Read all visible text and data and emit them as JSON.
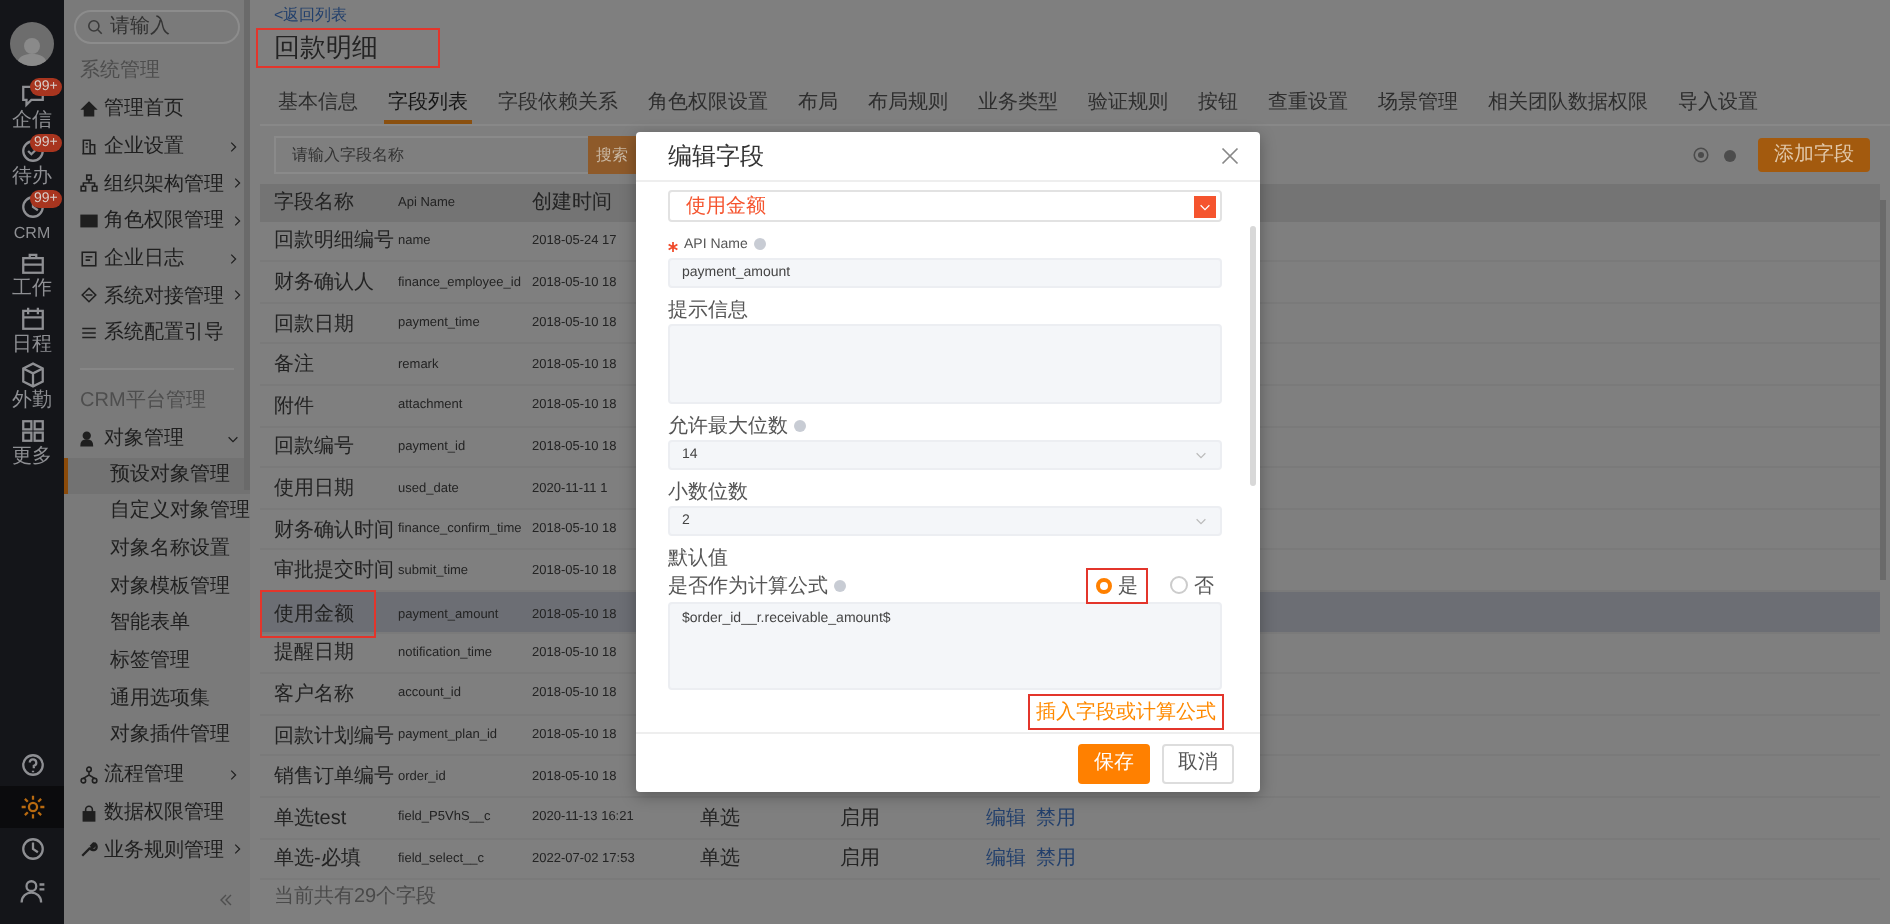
{
  "rail": {
    "items": [
      {
        "label": "企信",
        "badge": "99+"
      },
      {
        "label": "待办",
        "badge": "99+"
      },
      {
        "label": "CRM",
        "badge": "99+"
      },
      {
        "label": "工作"
      },
      {
        "label": "日程"
      },
      {
        "label": "外勤"
      },
      {
        "label": "更多"
      }
    ],
    "bottom": [
      {
        "selected": false
      },
      {
        "selected": true
      },
      {
        "selected": false
      },
      {
        "selected": false
      }
    ]
  },
  "sidebar": {
    "search": {
      "placeholder": "请输入"
    },
    "sections": [
      {
        "title": "系统管理",
        "items": [
          {
            "label": "管理首页",
            "expandable": false,
            "expanded": false
          },
          {
            "label": "企业设置",
            "expandable": true,
            "expanded": false
          },
          {
            "label": "组织架构管理",
            "expandable": true,
            "expanded": false
          },
          {
            "label": "角色权限管理",
            "expandable": true,
            "expanded": false
          },
          {
            "label": "企业日志",
            "expandable": true,
            "expanded": false
          },
          {
            "label": "系统对接管理",
            "expandable": true,
            "expanded": false
          },
          {
            "label": "系统配置引导",
            "expandable": false,
            "expanded": false
          }
        ]
      },
      {
        "title": "CRM平台管理",
        "items": [
          {
            "label": "对象管理",
            "expandable": true,
            "expanded": true,
            "children": [
              {
                "label": "预设对象管理",
                "selected": true
              },
              {
                "label": "自定义对象管理",
                "selected": false
              },
              {
                "label": "对象名称设置",
                "selected": false
              },
              {
                "label": "对象模板管理",
                "selected": false
              },
              {
                "label": "智能表单",
                "selected": false
              },
              {
                "label": "标签管理",
                "selected": false
              },
              {
                "label": "通用选项集",
                "selected": false
              },
              {
                "label": "对象插件管理",
                "selected": false
              }
            ]
          },
          {
            "label": "流程管理",
            "expandable": true,
            "expanded": false
          },
          {
            "label": "数据权限管理",
            "expandable": false,
            "expanded": false
          },
          {
            "label": "业务规则管理",
            "expandable": true,
            "expanded": false
          }
        ]
      }
    ]
  },
  "main": {
    "back_link": "<返回列表",
    "title": {
      "text": "回款明细",
      "highlighted": true
    },
    "tabs": [
      {
        "label": "基本信息",
        "selected": false
      },
      {
        "label": "字段列表",
        "selected": true
      },
      {
        "label": "字段依赖关系",
        "selected": false
      },
      {
        "label": "角色权限设置",
        "selected": false
      },
      {
        "label": "布局",
        "selected": false
      },
      {
        "label": "布局规则",
        "selected": false
      },
      {
        "label": "业务类型",
        "selected": false
      },
      {
        "label": "验证规则",
        "selected": false
      },
      {
        "label": "按钮",
        "selected": false
      },
      {
        "label": "查重设置",
        "selected": false
      },
      {
        "label": "场景管理",
        "selected": false
      },
      {
        "label": "相关团队数据权限",
        "selected": false
      },
      {
        "label": "导入设置",
        "selected": false
      }
    ],
    "search": {
      "placeholder": "请输入字段名称",
      "button": "搜索"
    },
    "add_button": "添加字段",
    "table": {
      "columns": [
        "字段名称",
        "Api Name",
        "创建时间"
      ],
      "rows": [
        {
          "cells": [
            "回款明细编号",
            "name",
            "2018-05-24 17"
          ],
          "actions": [],
          "selected": false,
          "highlighted": false
        },
        {
          "cells": [
            "财务确认人",
            "finance_employee_id",
            "2018-05-10 18"
          ],
          "actions": [],
          "selected": false,
          "highlighted": false
        },
        {
          "cells": [
            "回款日期",
            "payment_time",
            "2018-05-10 18"
          ],
          "actions": [],
          "selected": false,
          "highlighted": false
        },
        {
          "cells": [
            "备注",
            "remark",
            "2018-05-10 18"
          ],
          "actions": [],
          "selected": false,
          "highlighted": false
        },
        {
          "cells": [
            "附件",
            "attachment",
            "2018-05-10 18"
          ],
          "actions": [],
          "selected": false,
          "highlighted": false
        },
        {
          "cells": [
            "回款编号",
            "payment_id",
            "2018-05-10 18"
          ],
          "actions": [],
          "selected": false,
          "highlighted": false
        },
        {
          "cells": [
            "使用日期",
            "used_date",
            "2020-11-11 1"
          ],
          "actions": [],
          "selected": false,
          "highlighted": false
        },
        {
          "cells": [
            "财务确认时间",
            "finance_confirm_time",
            "2018-05-10 18"
          ],
          "actions": [],
          "selected": false,
          "highlighted": false
        },
        {
          "cells": [
            "审批提交时间",
            "submit_time",
            "2018-05-10 18"
          ],
          "actions": [],
          "selected": false,
          "highlighted": false
        },
        {
          "cells": [
            "使用金额",
            "payment_amount",
            "2018-05-10 18"
          ],
          "actions": [],
          "selected": true,
          "highlighted": true
        },
        {
          "cells": [
            "提醒日期",
            "notification_time",
            "2018-05-10 18"
          ],
          "actions": [],
          "selected": false,
          "highlighted": false
        },
        {
          "cells": [
            "客户名称",
            "account_id",
            "2018-05-10 18"
          ],
          "actions": [],
          "selected": false,
          "highlighted": false
        },
        {
          "cells": [
            "回款计划编号",
            "payment_plan_id",
            "2018-05-10 18"
          ],
          "actions": [],
          "selected": false,
          "highlighted": false
        },
        {
          "cells": [
            "销售订单编号",
            "order_id",
            "2018-05-10 18"
          ],
          "actions": [],
          "selected": false,
          "highlighted": false
        },
        {
          "cells": [
            "单选test",
            "field_P5VhS__c",
            "2020-11-13 16:21",
            "单选",
            "启用"
          ],
          "actions": [
            "编辑",
            "禁用"
          ],
          "selected": false,
          "highlighted": false
        },
        {
          "cells": [
            "单选-必填",
            "field_select__c",
            "2022-07-02 17:53",
            "单选",
            "启用"
          ],
          "actions": [
            "编辑",
            "禁用"
          ],
          "selected": false,
          "highlighted": false
        }
      ],
      "footer": "当前共有29个字段"
    }
  },
  "dialog": {
    "title": "编辑字段",
    "fields": [
      {
        "kind": "color_select",
        "value": "使用金额",
        "color": "#f5542e"
      },
      {
        "kind": "input",
        "label": "API Name",
        "required": true,
        "info": true,
        "value": "payment_amount"
      },
      {
        "kind": "textarea",
        "label": "提示信息",
        "required": false,
        "info": false
      },
      {
        "kind": "select",
        "label": "允许最大位数",
        "required": false,
        "info": true,
        "value": "14"
      },
      {
        "kind": "select",
        "label": "小数位数",
        "required": false,
        "info": false,
        "value": "2"
      },
      {
        "kind": "formula",
        "label": "默认值",
        "sublabel": "是否作为计算公式",
        "required": false,
        "info": true,
        "options": [
          {
            "label": "是",
            "selected": true,
            "annotated": true
          },
          {
            "label": "否",
            "selected": false,
            "annotated": false
          }
        ],
        "value": "$order_id__r.receivable_amount$",
        "link": {
          "text": "插入字段或计算公式",
          "highlighted": true
        }
      }
    ],
    "buttons": [
      {
        "label": "保存",
        "kind": "primary"
      },
      {
        "label": "取消",
        "kind": "default"
      }
    ]
  }
}
